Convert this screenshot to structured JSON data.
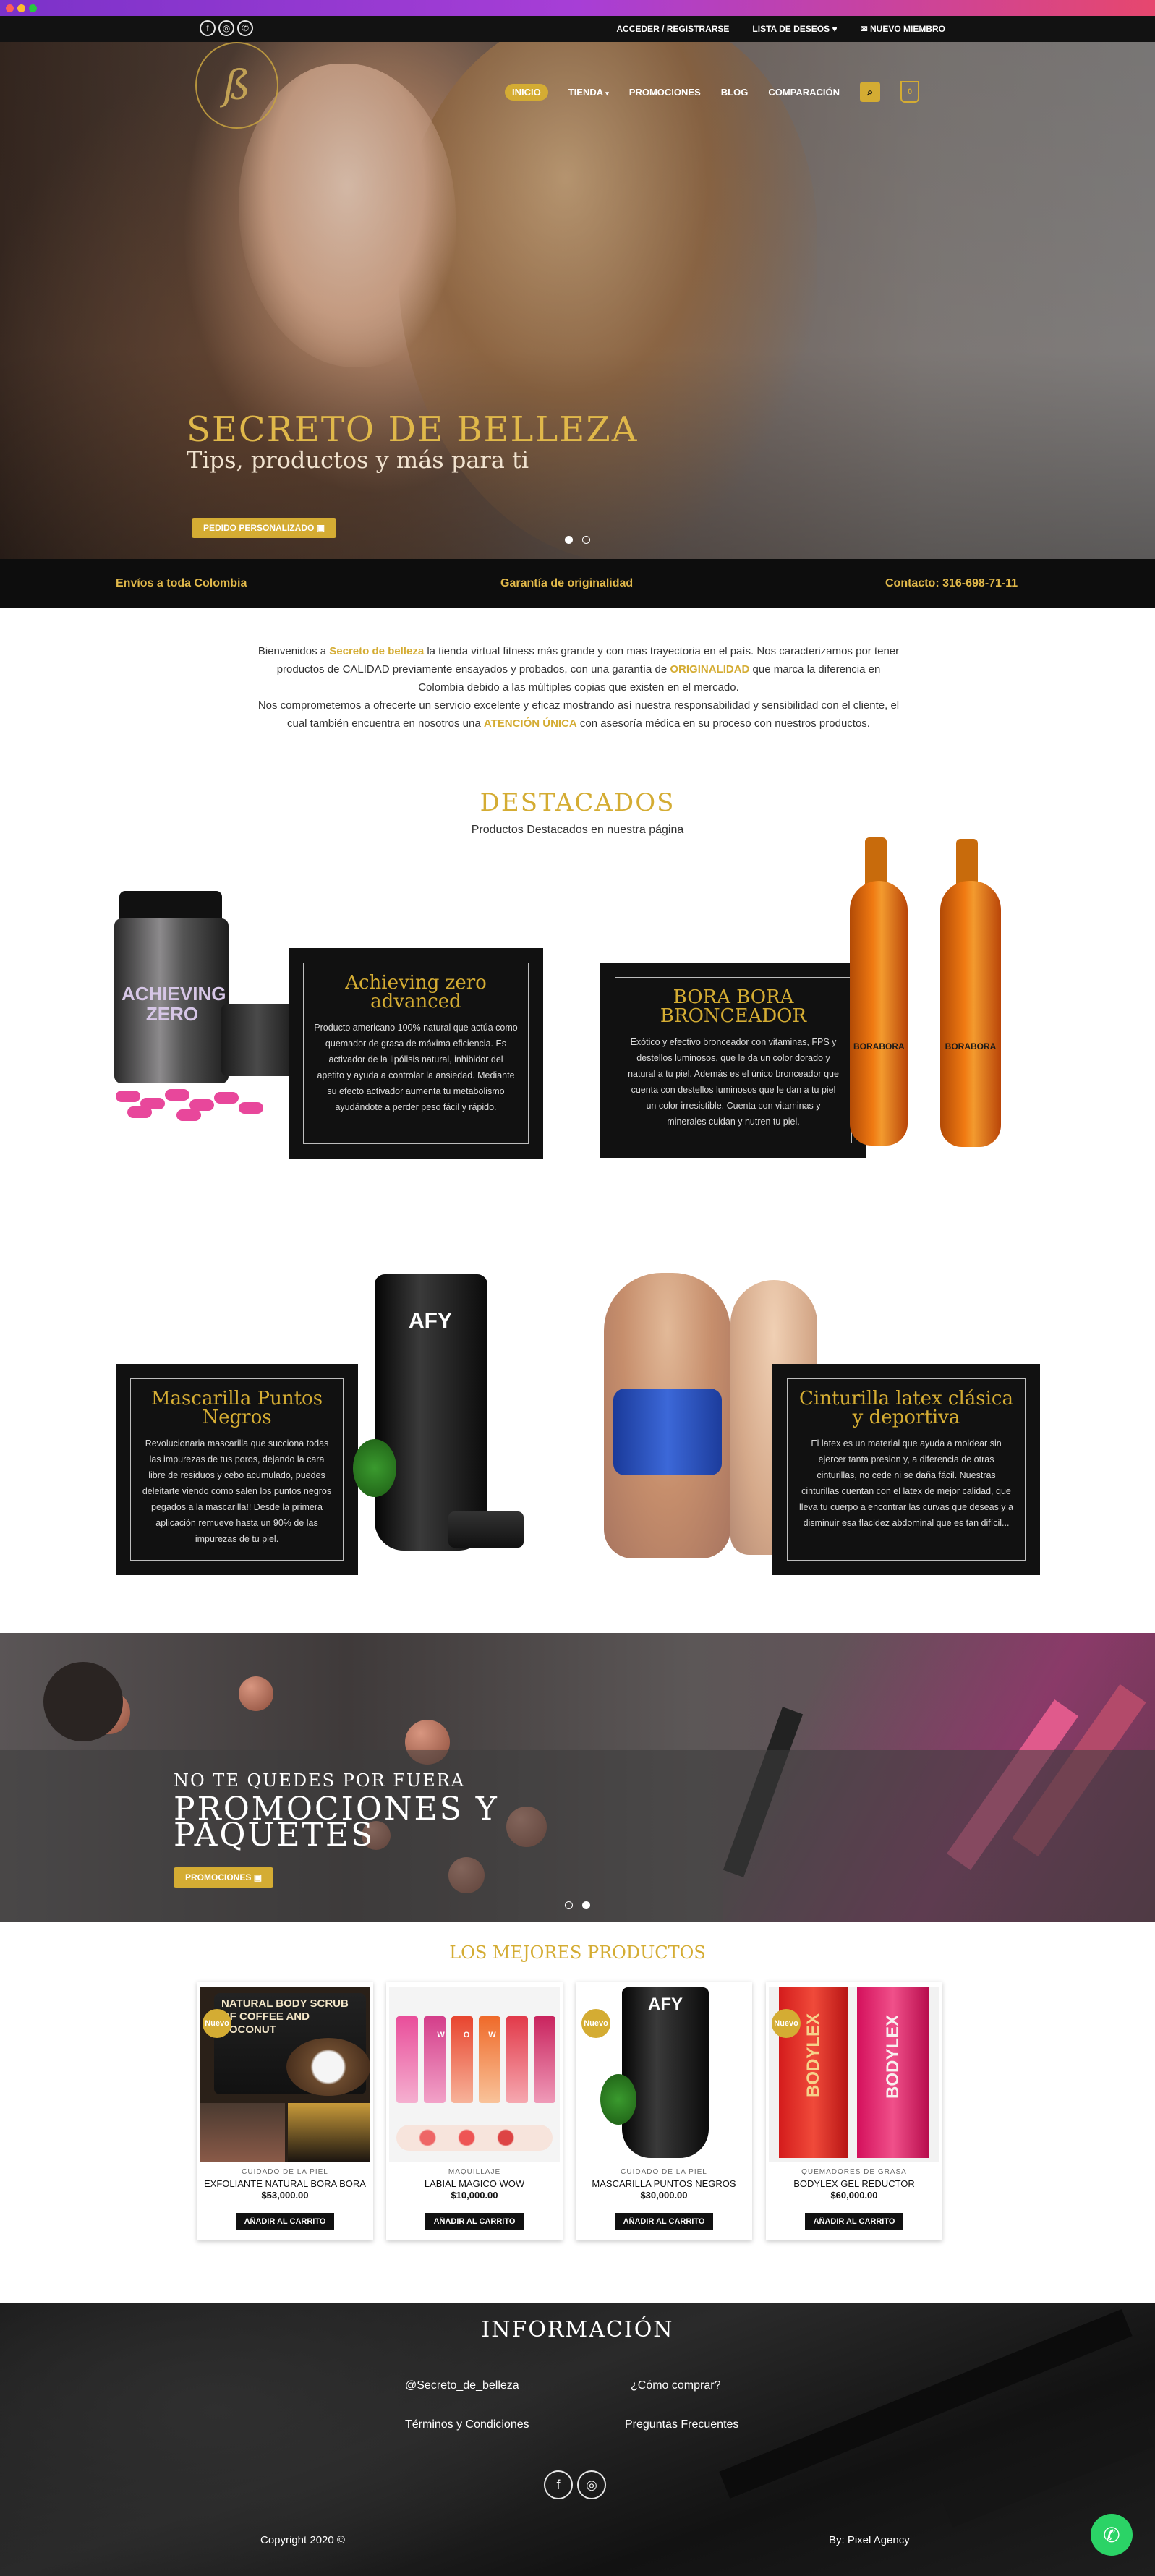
{
  "topbar": {
    "social_icons": [
      "facebook-icon",
      "instagram-icon",
      "phone-icon"
    ],
    "login": "ACCEDER / REGISTRARSE",
    "wishlist": "LISTA DE DESEOS",
    "new_member": "NUEVO MIEMBRO"
  },
  "nav": {
    "items": [
      "INICIO",
      "TIENDA",
      "PROMOCIONES",
      "BLOG",
      "COMPARACIÓN"
    ],
    "cart_count": "0"
  },
  "hero": {
    "title": "SECRETO DE BELLEZA",
    "subtitle": "Tips, productos y más para ti",
    "button": "PEDIDO PERSONALIZADO"
  },
  "infobar": {
    "left": "Envíos a toda Colombia",
    "center": "Garantía de originalidad",
    "right": "Contacto: 316-698-71-11"
  },
  "intro": {
    "p1a": "Bienvenidos a ",
    "brand": "Secreto de belleza",
    "p1b": " la tienda virtual fitness más grande y con mas trayectoria en el país. Nos caracterizamos por tener productos de CALIDAD previamente ensayados y probados, con una garantía de ",
    "originality": "ORIGINALIDAD",
    "p1c": " que marca la diferencia en Colombia debido a las múltiples copias que existen en el mercado.",
    "p2a": "Nos comprometemos a ofrecerte un servicio excelente y eficaz mostrando así nuestra responsabilidad y sensibilidad con el cliente, el cual también encuentra en nosotros una ",
    "attention": "ATENCIÓN ÚNICA",
    "p2b": " con asesoría médica en su proceso con nuestros productos."
  },
  "featured": {
    "title": "DESTACADOS",
    "subtitle": "Productos Destacados en nuestra página",
    "cards": [
      {
        "title": "Achieving zero advanced",
        "text": "Producto americano 100% natural que actúa como quemador de grasa de máxima eficiencia. Es activador de la lipólisis natural, inhibidor del apetito y ayuda a controlar la ansiedad. Mediante su efecto activador aumenta tu metabolismo ayudándote a perder peso fácil y rápido."
      },
      {
        "title": "BORA BORA BRONCEADOR",
        "text": "Exótico y efectivo bronceador con vitaminas, FPS y destellos luminosos, que le da un color dorado y natural a tu piel. Además es el único bronceador que cuenta con destellos luminosos que le dan a tu piel un color irresistible. Cuenta con vitaminas y minerales cuidan y nutren tu piel."
      },
      {
        "title": "Mascarilla Puntos Negros",
        "text": "Revolucionaria mascarilla que succiona todas las impurezas de tus poros, dejando la cara libre de residuos y cebo acumulado, puedes deleitarte viendo como salen los puntos negros pegados a la mascarilla!! Desde la primera aplicación remueve hasta un 90% de las impurezas de tu piel."
      },
      {
        "title": "Cinturilla latex clásica y deportiva",
        "text": "El latex es un material que ayuda a moldear sin ejercer tanta presion y, a diferencia de otras cinturillas, no cede ni se daña fácil. Nuestras cinturillas cuentan con el latex de mejor calidad, que lleva tu cuerpo a encontrar las curvas que deseas y a disminuir esa flacidez abdominal que es tan difícil..."
      }
    ],
    "product_labels": {
      "jar": "ACHIEVING ZERO",
      "bottle": "BORABORA",
      "tube": "AFY"
    }
  },
  "promo": {
    "kicker": "NO TE QUEDES POR FUERA",
    "title_line1": "PROMOCIONES Y",
    "title_line2": "PAQUETES",
    "button": "PROMOCIONES"
  },
  "best": {
    "title": "LOS MEJORES PRODUCTOS",
    "button_label": "AÑADIR AL CARRITO",
    "badge": "Nuevo",
    "products": [
      {
        "category": "CUIDADO DE LA PIEL",
        "name": "EXFOLIANTE NATURAL BORA BORA",
        "price": "$53,000.00",
        "image_text": "NATURAL BODY SCRUB OF COFFEE AND COCONUT"
      },
      {
        "category": "MAQUILLAJE",
        "name": "LABIAL MAGICO WOW",
        "price": "$10,000.00",
        "image_text": "WOW"
      },
      {
        "category": "CUIDADO DE LA PIEL",
        "name": "MASCARILLA PUNTOS NEGROS",
        "price": "$30,000.00",
        "image_text": "AFY"
      },
      {
        "category": "QUEMADORES DE GRASA",
        "name": "BODYLEX GEL REDUCTOR",
        "price": "$60,000.00",
        "image_text": "BODYLEX"
      }
    ]
  },
  "footer": {
    "title": "INFORMACIÓN",
    "links": [
      "@Secreto_de_belleza",
      "¿Cómo comprar?",
      "Términos y Condiciones",
      "Preguntas Frecuentes"
    ],
    "copyright": "Copyright 2020 ©",
    "credit": "By: Pixel Agency"
  },
  "colors": {
    "gold": "#d4ac33",
    "dark": "#111111",
    "whatsapp": "#2bd366"
  }
}
